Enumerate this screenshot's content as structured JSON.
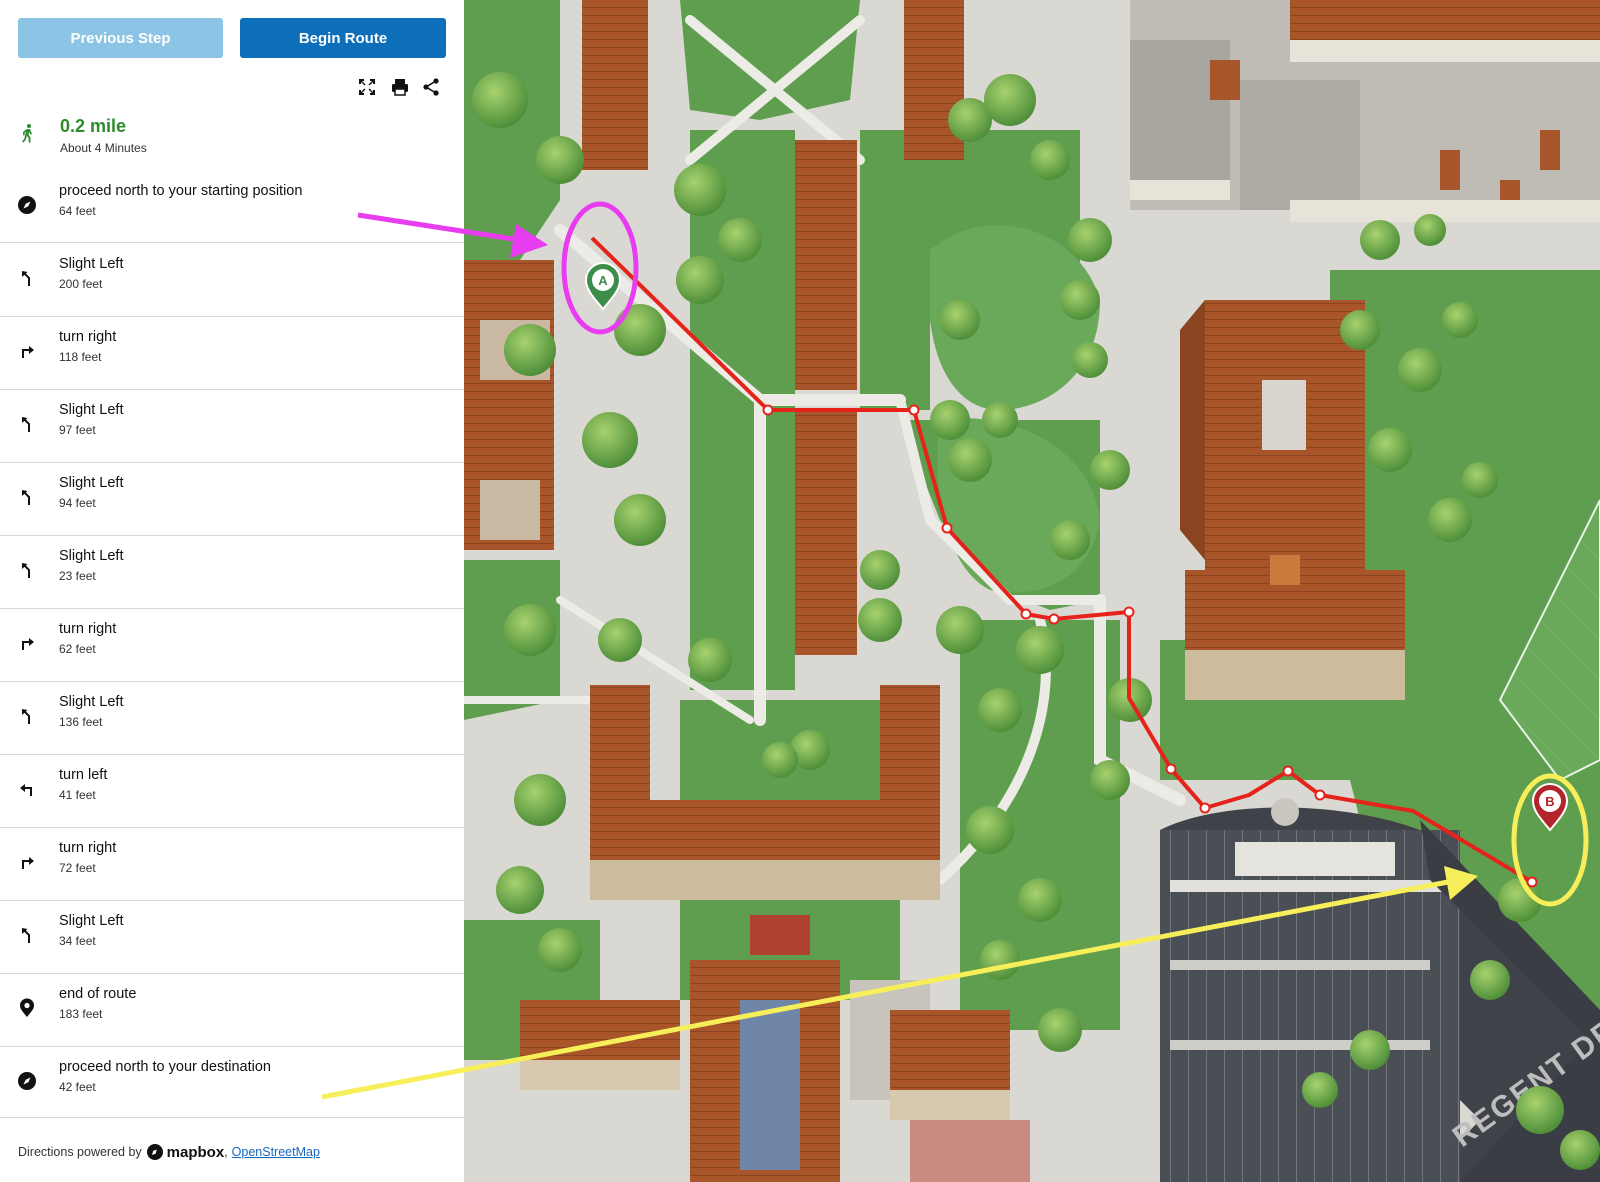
{
  "toolbar": {
    "previous_label": "Previous Step",
    "begin_label": "Begin Route"
  },
  "summary": {
    "distance": "0.2 mile",
    "duration": "About 4 Minutes"
  },
  "steps": [
    {
      "icon": "compass-icon",
      "title": "proceed north to your starting position",
      "distance": "64 feet"
    },
    {
      "icon": "slight-left-icon",
      "title": "Slight Left",
      "distance": "200 feet"
    },
    {
      "icon": "turn-right-icon",
      "title": "turn right",
      "distance": "118 feet"
    },
    {
      "icon": "slight-left-icon",
      "title": "Slight Left",
      "distance": "97 feet"
    },
    {
      "icon": "slight-left-icon",
      "title": "Slight Left",
      "distance": "94 feet"
    },
    {
      "icon": "slight-left-icon",
      "title": "Slight Left",
      "distance": "23 feet"
    },
    {
      "icon": "turn-right-icon",
      "title": "turn right",
      "distance": "62 feet"
    },
    {
      "icon": "slight-left-icon",
      "title": "Slight Left",
      "distance": "136 feet"
    },
    {
      "icon": "turn-left-icon",
      "title": "turn left",
      "distance": "41 feet"
    },
    {
      "icon": "turn-right-icon",
      "title": "turn right",
      "distance": "72 feet"
    },
    {
      "icon": "slight-left-icon",
      "title": "Slight Left",
      "distance": "34 feet"
    },
    {
      "icon": "location-pin-icon",
      "title": "end of route",
      "distance": "183 feet"
    },
    {
      "icon": "compass-icon",
      "title": "proceed north to your destination",
      "distance": "42 feet"
    }
  ],
  "footer": {
    "prefix": "Directions powered by",
    "brand": "mapbox",
    "separator": ",",
    "osm_link": "OpenStreetMap"
  },
  "map": {
    "marker_a": "A",
    "marker_b": "B",
    "street_label": "REGENT DR"
  },
  "colors": {
    "accent": "#0d6fba",
    "accent_disabled": "#8cc4e6",
    "summary_green": "#2e8b2e",
    "route": "#e5231b",
    "start_marker": "#3c8c4a",
    "end_marker": "#b3242b",
    "annotation_magenta": "#e83cf0",
    "annotation_yellow": "#f7ef5a"
  }
}
